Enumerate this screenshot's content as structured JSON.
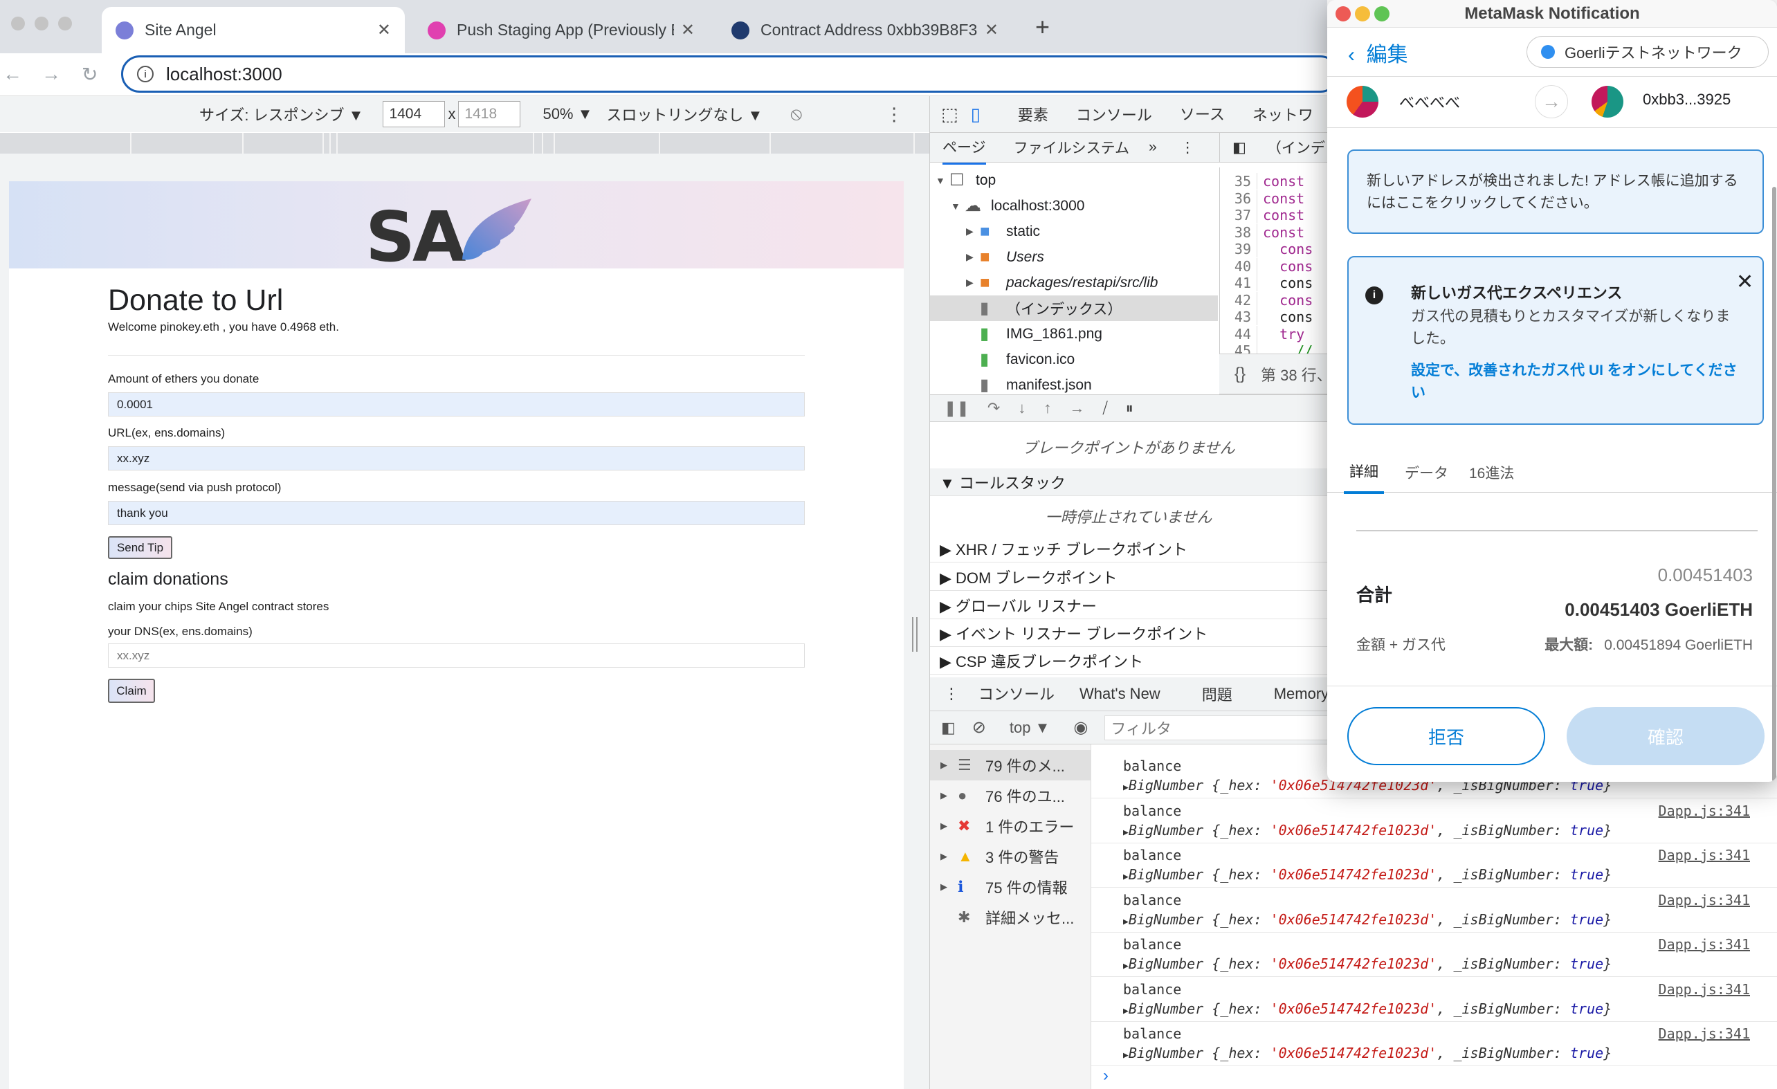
{
  "browser": {
    "tabs": [
      {
        "title": "Site Angel",
        "color": "#7b7fd8"
      },
      {
        "title": "Push Staging App (Previously E",
        "color": "#e040b0"
      },
      {
        "title": "Contract Address 0xbb39B8F3",
        "color": "#1f3a6e"
      }
    ],
    "new_tab": "+",
    "url": "localhost:3000"
  },
  "device_toolbar": {
    "size": "サイズ: レスポンシブ ▼",
    "width": "1404",
    "times": "x",
    "height": "1418",
    "zoom": "50% ▼",
    "throttle": "スロットリングなし ▼"
  },
  "page": {
    "logo": "SA",
    "title": "Donate to Url",
    "welcome": "Welcome pinokey.eth , you have 0.4968 eth.",
    "amount_label": "Amount of ethers you donate",
    "amount_value": "0.0001",
    "url_label": "URL(ex, ens.domains)",
    "url_value": "xx.xyz",
    "message_label": "message(send via push protocol)",
    "message_value": "thank you",
    "send_tip": "Send Tip",
    "claim_title": "claim donations",
    "claim_desc": "claim your chips Site Angel contract stores",
    "dns_label": "your DNS(ex, ens.domains)",
    "dns_placeholder": "xx.xyz",
    "claim_button": "Claim"
  },
  "devtools": {
    "tabs": [
      "要素",
      "コンソール",
      "ソース",
      "ネットワ"
    ],
    "active_tab": "ソース",
    "sources_tabs": [
      "ページ",
      "ファイルシステム",
      "»"
    ],
    "editor_tab": "（インデ",
    "tree": [
      {
        "label": "top",
        "icon": "frame",
        "depth": 0,
        "arrow": "▼"
      },
      {
        "label": "localhost:3000",
        "icon": "cloud",
        "depth": 1,
        "arrow": "▼"
      },
      {
        "label": "static",
        "icon": "folder-blue",
        "depth": 2,
        "arrow": "▶"
      },
      {
        "label": "Users",
        "icon": "folder-orange",
        "depth": 2,
        "arrow": "▶",
        "italic": true
      },
      {
        "label": "packages/restapi/src/lib",
        "icon": "folder-orange",
        "depth": 2,
        "arrow": "▶",
        "italic": true
      },
      {
        "label": "（インデックス）",
        "icon": "file-gray",
        "depth": 2,
        "arrow": "",
        "selected": true
      },
      {
        "label": "IMG_1861.png",
        "icon": "file-green",
        "depth": 2,
        "arrow": ""
      },
      {
        "label": "favicon.ico",
        "icon": "file-green",
        "depth": 2,
        "arrow": ""
      },
      {
        "label": "manifest.json",
        "icon": "file-gray",
        "depth": 2,
        "arrow": ""
      }
    ],
    "code": [
      {
        "n": "35",
        "t": "const",
        "c": "#a0288f"
      },
      {
        "n": "36",
        "t": "const",
        "c": "#a0288f"
      },
      {
        "n": "37",
        "t": "const",
        "c": "#a0288f"
      },
      {
        "n": "38",
        "t": "const",
        "c": "#a0288f"
      },
      {
        "n": "39",
        "t": "  cons",
        "c": "#a0288f"
      },
      {
        "n": "40",
        "t": "  cons",
        "c": "#a0288f"
      },
      {
        "n": "41",
        "t": "  cons",
        "c": "#222"
      },
      {
        "n": "42",
        "t": "  cons",
        "c": "#a0288f"
      },
      {
        "n": "43",
        "t": "  cons",
        "c": "#222"
      },
      {
        "n": "44",
        "t": "  try",
        "c": "#a0288f"
      },
      {
        "n": "45",
        "t": "    //",
        "c": "#1a8f1a"
      }
    ],
    "status": "第 38 行、",
    "format": "{}",
    "no_breakpoints": "ブレークポイントがありません",
    "callstack": "▼ コールスタック",
    "not_paused": "一時停止されていません",
    "sections": [
      "▶ XHR / フェッチ ブレークポイント",
      "▶ DOM ブレークポイント",
      "▶ グローバル リスナー",
      "▶ イベント リスナー ブレークポイント",
      "▶ CSP 違反ブレークポイント"
    ],
    "drawer_tabs": [
      "コンソール",
      "What's New",
      "問題",
      "Memory"
    ],
    "context": "top ▼",
    "filter_placeholder": "フィルタ",
    "console_sidebar": [
      {
        "label": "79 件のメ...",
        "icon": "list",
        "color": "#666"
      },
      {
        "label": "76 件のユ...",
        "icon": "user",
        "color": "#666"
      },
      {
        "label": "1 件のエラー",
        "icon": "error",
        "color": "#e53935"
      },
      {
        "label": "3 件の警告",
        "icon": "warning",
        "color": "#f4b400"
      },
      {
        "label": "75 件の情報",
        "icon": "info",
        "color": "#1a56db"
      },
      {
        "label": "詳細メッセ...",
        "icon": "bug",
        "color": "#666"
      }
    ],
    "messages": [
      {
        "label": "balance",
        "prefix": "BigNumber {_hex: ",
        "hex": "'0x06e514742fe1023d'",
        "mid": ", _isBigNumber: ",
        "bool": "true",
        "end": "}",
        "source": "Dapp.js:341"
      },
      {
        "label": "balance",
        "prefix": "BigNumber {_hex: ",
        "hex": "'0x06e514742fe1023d'",
        "mid": ", _isBigNumber: ",
        "bool": "true",
        "end": "}",
        "source": "Dapp.js:341"
      },
      {
        "label": "balance",
        "prefix": "BigNumber {_hex: ",
        "hex": "'0x06e514742fe1023d'",
        "mid": ", _isBigNumber: ",
        "bool": "true",
        "end": "}",
        "source": "Dapp.js:341"
      },
      {
        "label": "balance",
        "prefix": "BigNumber {_hex: ",
        "hex": "'0x06e514742fe1023d'",
        "mid": ", _isBigNumber: ",
        "bool": "true",
        "end": "}",
        "source": "Dapp.js:341"
      },
      {
        "label": "balance",
        "prefix": "BigNumber {_hex: ",
        "hex": "'0x06e514742fe1023d'",
        "mid": ", _isBigNumber: ",
        "bool": "true",
        "end": "}",
        "source": "Dapp.js:341"
      },
      {
        "label": "balance",
        "prefix": "BigNumber {_hex: ",
        "hex": "'0x06e514742fe1023d'",
        "mid": ", _isBigNumber: ",
        "bool": "true",
        "end": "}",
        "source": "Dapp.js:341"
      },
      {
        "label": "balance",
        "prefix": "BigNumber {_hex: ",
        "hex": "'0x06e514742fe1023d'",
        "mid": ", _isBigNumber: ",
        "bool": "true",
        "end": "}",
        "source": "Dapp.js:341"
      }
    ],
    "prompt": "›"
  },
  "metamask": {
    "window_title": "MetaMask Notification",
    "back": "編集",
    "network": "Goerliテストネットワーク",
    "network_color": "#2f8ff0",
    "from": "べべべべ",
    "to": "0xbb3...3925",
    "new_address_notice": "新しいアドレスが検出されました! アドレス帳に追加するにはここをクリックしてください。",
    "gas_title": "新しいガス代エクスペリエンス",
    "gas_body": "ガス代の見積もりとカスタマイズが新しくなりました。",
    "gas_link": "設定で、改善されたガス代 UI をオンにしてください",
    "tabs": [
      "詳細",
      "データ",
      "16進法"
    ],
    "active_tab": "詳細",
    "total_label": "合計",
    "total_secondary": "0.00451403",
    "total_primary": "0.00451403 GoerliETH",
    "amount_gas_label": "金額 + ガス代",
    "max_label": "最大額:",
    "max_value": "0.00451894 GoerliETH",
    "reject": "拒否",
    "confirm": "確認",
    "accent": "#037dd6"
  }
}
